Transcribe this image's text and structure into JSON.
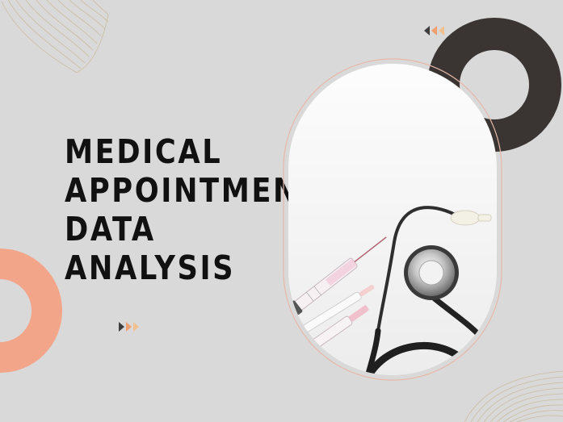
{
  "slide": {
    "title_lines": [
      "MEDICAL",
      "APPOINTMENT",
      "DATA",
      "ANALYSIS"
    ]
  },
  "colors": {
    "background": "#d9d9d9",
    "dark_ring": "#3a3533",
    "peach_ring": "#f3a58a",
    "title_text": "#111111",
    "arrow_dark": "#3d3d3d",
    "arrow_orange": "#f0a070",
    "wave_lines": "#c9b99a",
    "photo_border": "#e7b8a8"
  },
  "icons": [
    "wave-lines-decoration",
    "triangle-arrows-icon",
    "ring-decoration",
    "stethoscope-icon",
    "syringe-icon"
  ]
}
